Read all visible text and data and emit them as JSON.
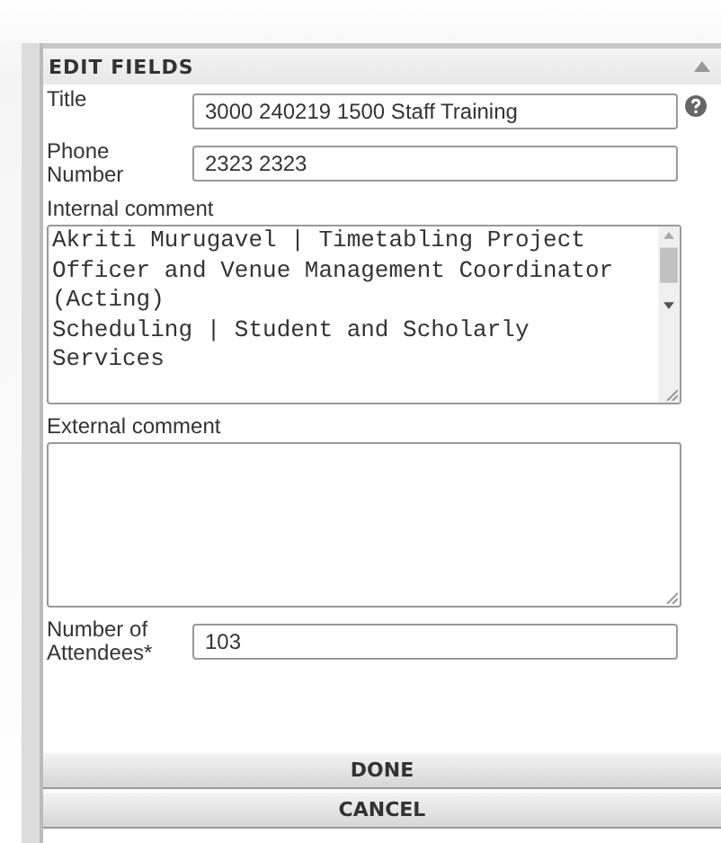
{
  "panel": {
    "title": "EDIT FIELDS",
    "collapsed": false
  },
  "fields": [
    {
      "kind": "text",
      "label": "Title",
      "value": "3000 240219 1500 Staff Training",
      "help": true
    },
    {
      "kind": "text",
      "label": "Phone Number",
      "value": "2323 2323"
    },
    {
      "kind": "textarea",
      "label": "Internal comment",
      "value": "Akriti Murugavel | Timetabling Project Officer and Venue Management Coordinator (Acting)\nScheduling | Student and Scholarly Services",
      "scrollbar": true
    },
    {
      "kind": "textarea",
      "label": "External comment"
    },
    {
      "kind": "text",
      "label": "Number of Attendees*",
      "value": "103"
    }
  ],
  "buttons": [
    "DONE",
    "CANCEL"
  ]
}
